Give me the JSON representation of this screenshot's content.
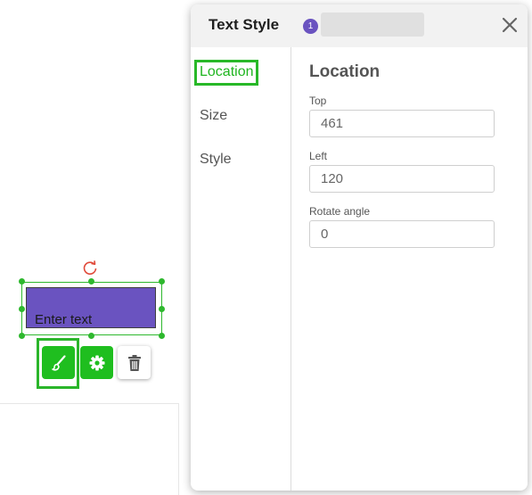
{
  "canvas": {
    "text_element": {
      "text": "Enter text"
    },
    "toolbar": {
      "style_button_icon": "brush-icon",
      "settings_button_icon": "gear-icon",
      "delete_button_icon": "trash-icon"
    }
  },
  "panel": {
    "title": "Text Style",
    "badge": "1",
    "close_icon": "close-icon",
    "nav": [
      {
        "label": "Location",
        "active": true
      },
      {
        "label": "Size",
        "active": false
      },
      {
        "label": "Style",
        "active": false
      }
    ],
    "section_title": "Location",
    "fields": {
      "top": {
        "label": "Top",
        "value": "461"
      },
      "left": {
        "label": "Left",
        "value": "120"
      },
      "rotate": {
        "label": "Rotate angle",
        "value": "0"
      }
    }
  },
  "colors": {
    "accent": "#1fbe1f",
    "text_block_fill": "#6a53c0",
    "badge": "#6a53c0",
    "rotate_handle": "#e04a3a"
  }
}
